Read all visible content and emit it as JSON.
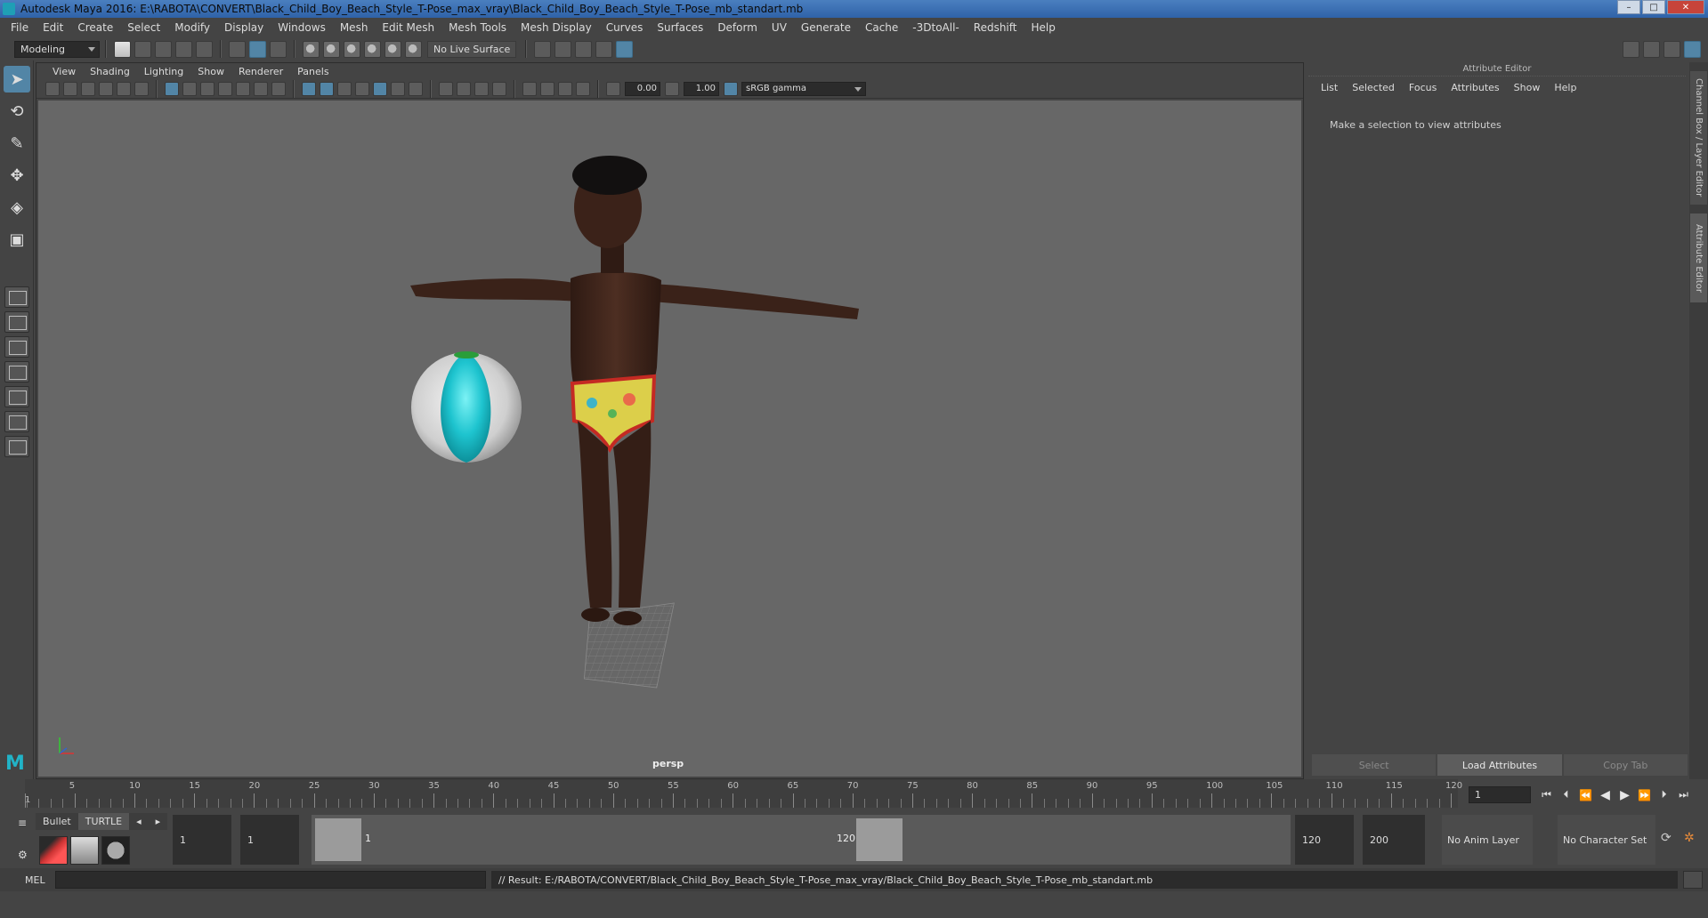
{
  "window": {
    "title": "Autodesk Maya 2016: E:\\RABOTA\\CONVERT\\Black_Child_Boy_Beach_Style_T-Pose_max_vray\\Black_Child_Boy_Beach_Style_T-Pose_mb_standart.mb",
    "minimize": "–",
    "maximize": "□",
    "close": "✕"
  },
  "menubar": {
    "items": [
      "File",
      "Edit",
      "Create",
      "Select",
      "Modify",
      "Display",
      "Windows",
      "Mesh",
      "Edit Mesh",
      "Mesh Tools",
      "Mesh Display",
      "Curves",
      "Surfaces",
      "Deform",
      "UV",
      "Generate",
      "Cache",
      "-3DtoAll-",
      "Redshift",
      "Help"
    ]
  },
  "statusline": {
    "mode": "Modeling",
    "live_surface": "No Live Surface"
  },
  "viewport": {
    "menus": [
      "View",
      "Shading",
      "Lighting",
      "Show",
      "Renderer",
      "Panels"
    ],
    "exposure": "0.00",
    "gamma": "1.00",
    "color_space": "sRGB gamma",
    "camera_label": "persp"
  },
  "attribute_editor": {
    "title": "Attribute Editor",
    "menus": [
      "List",
      "Selected",
      "Focus",
      "Attributes",
      "Show",
      "Help"
    ],
    "message": "Make a selection to view attributes",
    "buttons": {
      "select": "Select",
      "load": "Load Attributes",
      "copy": "Copy Tab"
    },
    "side_tabs": {
      "channel_box": "Channel Box / Layer Editor",
      "attribute_editor": "Attribute Editor"
    }
  },
  "timeline": {
    "tick_labels": [
      "5",
      "10",
      "15",
      "20",
      "25",
      "30",
      "35",
      "40",
      "45",
      "50",
      "55",
      "60",
      "65",
      "70",
      "75",
      "80",
      "85",
      "90",
      "95",
      "100",
      "105",
      "110",
      "115",
      "120"
    ],
    "start_label": "1",
    "current_frame": "1"
  },
  "range": {
    "shelf_tabs": [
      "Bullet",
      "TURTLE"
    ],
    "start_time": "1",
    "playback_start": "1",
    "range_start": "1",
    "range_end": "120",
    "playback_end": "120",
    "end_time": "200",
    "anim_layer": "No Anim Layer",
    "character_set": "No Character Set"
  },
  "commandline": {
    "label": "MEL",
    "result": "// Result: E:/RABOTA/CONVERT/Black_Child_Boy_Beach_Style_T-Pose_max_vray/Black_Child_Boy_Beach_Style_T-Pose_mb_standart.mb"
  },
  "colors": {
    "accent": "#5285a6",
    "viewport_bg": "#676767",
    "ball_cyan": "#1ec4cf"
  }
}
